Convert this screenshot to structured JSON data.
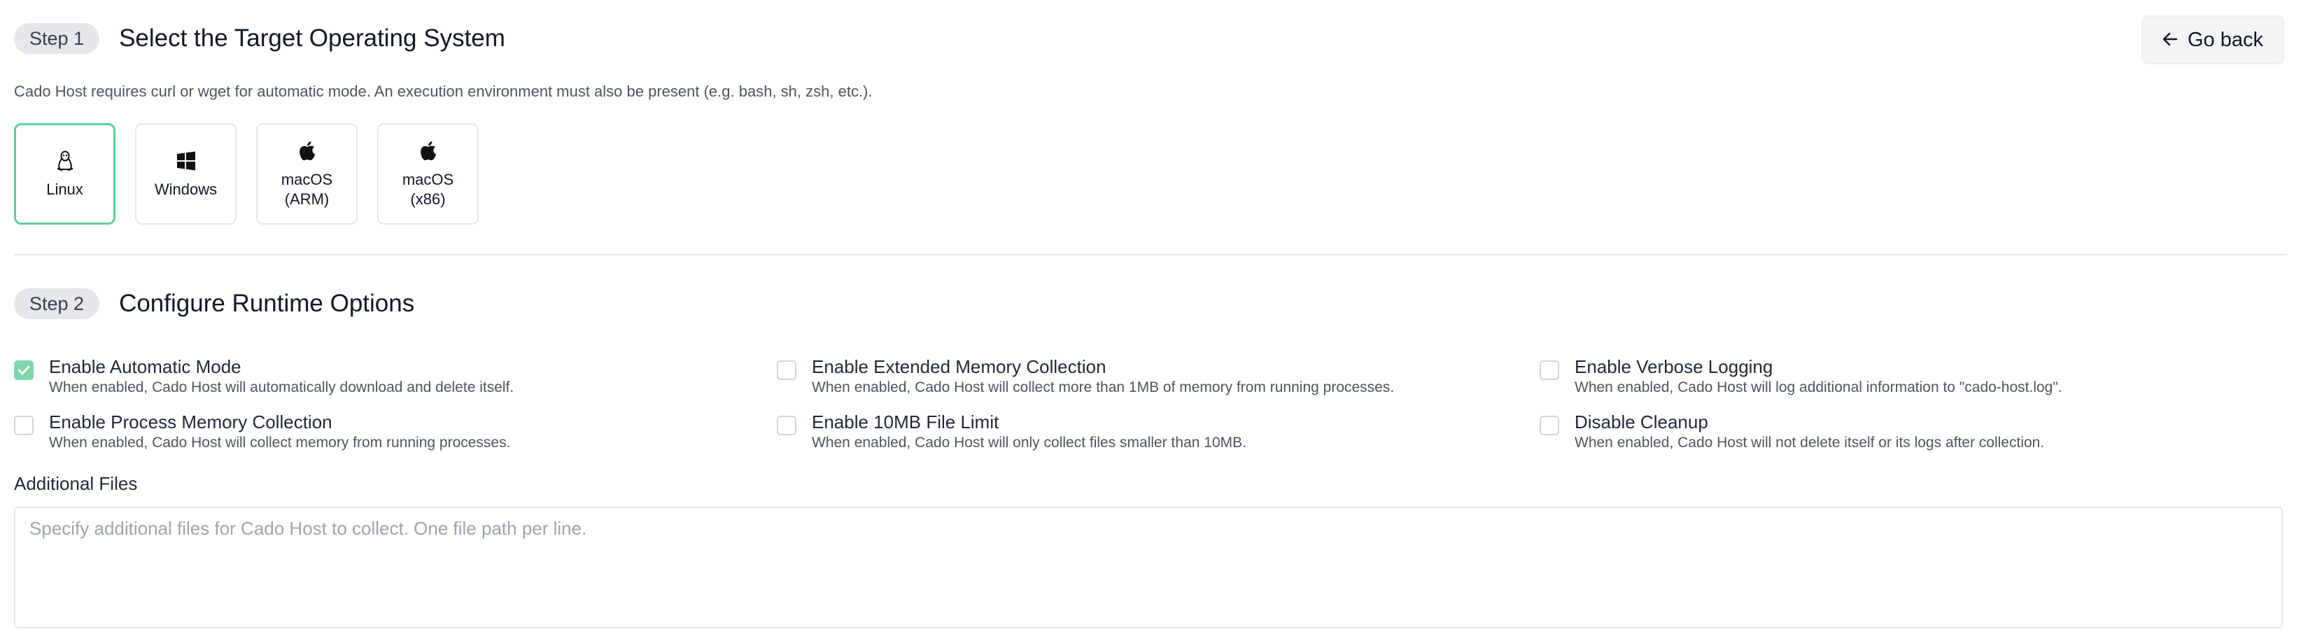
{
  "step1": {
    "pill": "Step 1",
    "title": "Select the Target Operating System",
    "go_back": "Go back",
    "description": "Cado Host requires curl or wget for automatic mode. An execution environment must also be present (e.g. bash, sh, zsh, etc.).",
    "os_options": [
      {
        "label": "Linux",
        "icon": "linux-icon",
        "selected": true
      },
      {
        "label": "Windows",
        "icon": "windows-icon",
        "selected": false
      },
      {
        "label": "macOS\n(ARM)",
        "icon": "apple-icon",
        "selected": false
      },
      {
        "label": "macOS\n(x86)",
        "icon": "apple-icon",
        "selected": false
      }
    ]
  },
  "step2": {
    "pill": "Step 2",
    "title": "Configure Runtime Options",
    "options": [
      {
        "title": "Enable Automatic Mode",
        "desc": "When enabled, Cado Host will automatically download and delete itself.",
        "checked": true
      },
      {
        "title": "Enable Extended Memory Collection",
        "desc": "When enabled, Cado Host will collect more than 1MB of memory from running processes.",
        "checked": false
      },
      {
        "title": "Enable Verbose Logging",
        "desc": "When enabled, Cado Host will log additional information to \"cado-host.log\".",
        "checked": false
      },
      {
        "title": "Enable Process Memory Collection",
        "desc": "When enabled, Cado Host will collect memory from running processes.",
        "checked": false
      },
      {
        "title": "Enable 10MB File Limit",
        "desc": "When enabled, Cado Host will only collect files smaller than 10MB.",
        "checked": false
      },
      {
        "title": "Disable Cleanup",
        "desc": "When enabled, Cado Host will not delete itself or its logs after collection.",
        "checked": false
      }
    ],
    "additional_files": {
      "label": "Additional Files",
      "value": "",
      "placeholder": "Specify additional files for Cado Host to collect. One file path per line."
    }
  },
  "colors": {
    "accent": "#5fcf9a",
    "checkbox_checked": "#7fd6a8",
    "pill_bg": "#e5e7eb"
  }
}
